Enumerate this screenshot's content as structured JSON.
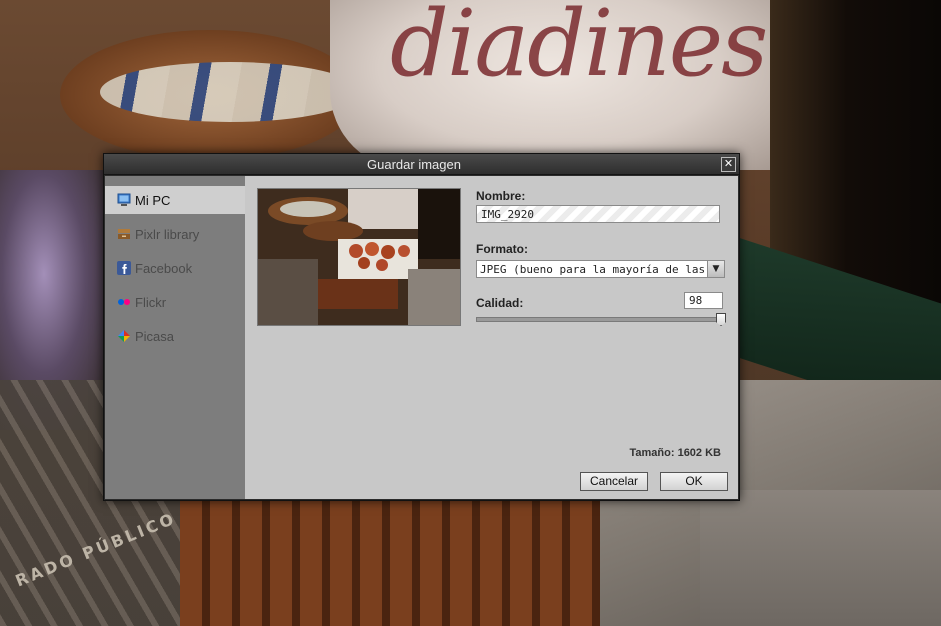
{
  "dialog": {
    "title": "Guardar imagen",
    "close_symbol": "✕"
  },
  "sidebar": {
    "items": [
      {
        "label": "Mi PC",
        "icon": "computer-icon",
        "active": true
      },
      {
        "label": "Pixlr library",
        "icon": "library-icon",
        "active": false
      },
      {
        "label": "Facebook",
        "icon": "facebook-icon",
        "active": false
      },
      {
        "label": "Flickr",
        "icon": "flickr-icon",
        "active": false
      },
      {
        "label": "Picasa",
        "icon": "picasa-icon",
        "active": false
      }
    ]
  },
  "form": {
    "name_label": "Nombre:",
    "name_value": "IMG_2920",
    "format_label": "Formato:",
    "format_value": "JPEG (bueno para la mayoría de las fotos)",
    "quality_label": "Calidad:",
    "quality_value": "98",
    "quality_level": 0.98,
    "size_label": "Tamaño: 1602 KB"
  },
  "buttons": {
    "cancel": "Cancelar",
    "ok": "OK"
  },
  "background": {
    "cushion_text": "diadines",
    "grate_text": "RADO PÚBLICO"
  }
}
